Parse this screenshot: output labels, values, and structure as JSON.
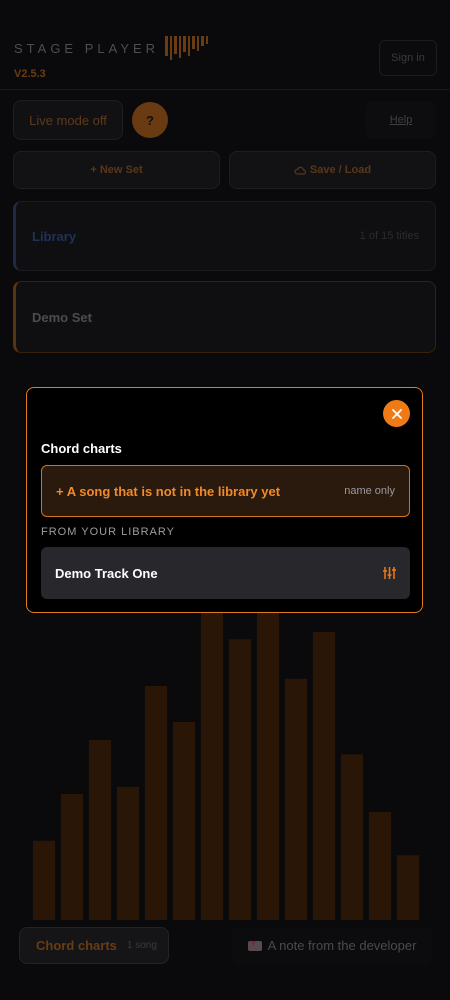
{
  "app": {
    "brand": "STAGE PLAYER",
    "version": "V2.5.3",
    "sign_in": "Sign in",
    "live_mode": "Live mode off",
    "help_circle": "?",
    "help_link": "Help",
    "new_set": "+ New Set",
    "save_load": "Save / Load",
    "library": {
      "title": "Library",
      "meta": "1 of 15 titles"
    },
    "demo_set": {
      "title": "Demo Set"
    },
    "footer": {
      "chord_charts": "Chord charts",
      "song_count": "1 song",
      "dev_note": "A note from the developer"
    }
  },
  "modal": {
    "title": "Chord charts",
    "new_song": {
      "label": "+ A song that is not in the library yet",
      "hint": "name only"
    },
    "section_label": "FROM YOUR LIBRARY",
    "tracks": [
      {
        "name": "Demo Track One"
      }
    ]
  },
  "colors": {
    "accent": "#f07a16",
    "modal_border": "#e07a1e",
    "background": "#0a0a0c"
  },
  "visualizer": {
    "levels": [
      0.22,
      0.35,
      0.5,
      0.37,
      0.65,
      0.55,
      0.88,
      0.78,
      0.88,
      0.67,
      0.8,
      0.46,
      0.3,
      0.18
    ]
  }
}
